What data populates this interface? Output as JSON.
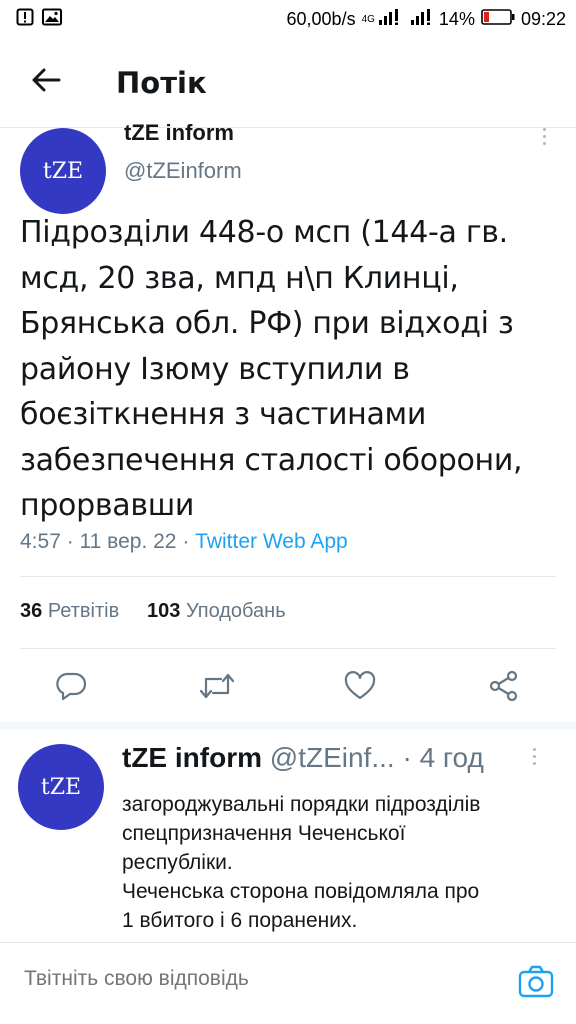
{
  "status_bar": {
    "speed": "60,00b/s",
    "network": "4G",
    "battery": "14%",
    "time": "09:22"
  },
  "header": {
    "title": "Потік"
  },
  "tweet": {
    "avatar_text": "tZE",
    "author_name": "tZE inform",
    "handle": "@tZEinform",
    "text_lines": [
      "Підрозділи 448-о мсп (144-а гв.",
      "мсд, 20 зва, мпд н\\п Клинці,",
      "Брянська обл. РФ) при відході з",
      "району Ізюму вступили в",
      "боєзіткнення з частинами",
      "забезпечення сталості оборони,",
      "прорвавши"
    ],
    "time": "4:57",
    "date": "11 вер. 22",
    "source": "Twitter Web App",
    "retweets_count": "36",
    "retweets_label": "Ретвітів",
    "likes_count": "103",
    "likes_label": "Уподобань"
  },
  "reply": {
    "avatar_text": "tZE",
    "author_name": "tZE inform",
    "handle": "@tZEinf...",
    "time_ago": "4 год",
    "text_lines": [
      "загороджувальні порядки підрозділів",
      "спецпризначення Чеченської",
      "республіки.",
      "Чеченська сторона повідомляла про",
      "1 вбитого і 6 поранених."
    ]
  },
  "composer": {
    "placeholder": "Твітніть свою відповідь"
  },
  "colors": {
    "avatar": "#3439c4",
    "accent": "#1da1f2",
    "muted": "#657786",
    "divider": "#e1e8ed"
  },
  "icons": [
    "alert-icon",
    "image-icon",
    "signal-icon",
    "battery-icon",
    "back-arrow-icon",
    "more-vertical-icon",
    "reply-icon",
    "retweet-icon",
    "like-icon",
    "share-icon",
    "camera-icon"
  ]
}
